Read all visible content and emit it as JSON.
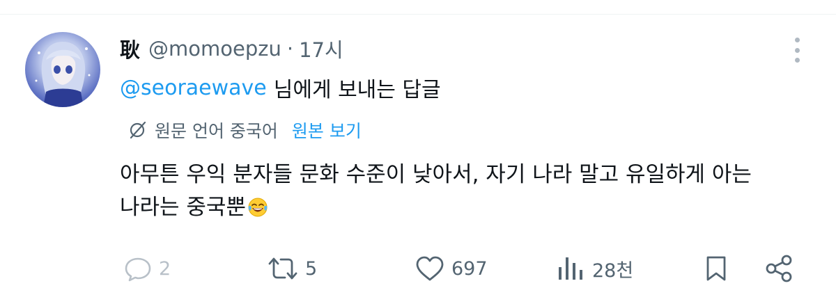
{
  "tweet": {
    "display_name": "耿",
    "handle": "@momoepzu",
    "separator": "·",
    "time": "17시",
    "reply_to_mention": "@seoraewave",
    "reply_to_suffix": "님에게 보내는 답글",
    "translation_label": "원문 언어 중국어",
    "show_original_label": "원본 보기",
    "text_line1": "아무튼 우익 분자들 문화 수준이 낮아서, 자기 나라 말고 유일하게 아는",
    "text_line2": "나라는 중국뿐",
    "emoji": "face-with-tears-of-joy"
  },
  "actions": {
    "reply_count": "2",
    "retweet_count": "5",
    "like_count": "697",
    "views_count": "28천"
  },
  "icons": {
    "reply": "speech-bubble-icon",
    "retweet": "retweet-icon",
    "like": "heart-icon",
    "views": "bar-chart-icon",
    "bookmark": "bookmark-icon",
    "share": "share-icon",
    "more": "more-dots-icon",
    "translate": "globe-slash-icon"
  },
  "colors": {
    "link": "#1d9bf0",
    "secondary_text": "#536471",
    "primary_text": "#0f1419"
  }
}
